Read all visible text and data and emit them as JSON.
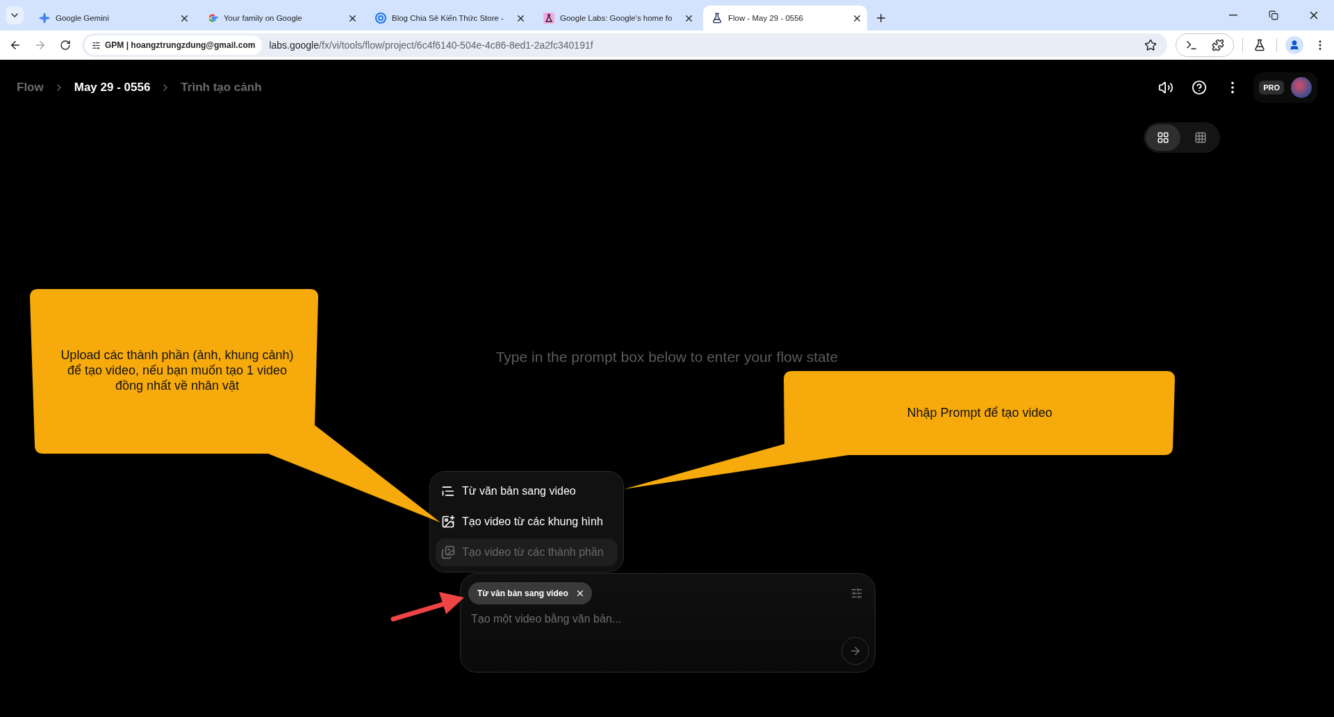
{
  "browser": {
    "tabs": [
      {
        "title": "Google Gemini",
        "kind": "sparkle",
        "selected": false
      },
      {
        "title": "Your family on Google",
        "kind": "google",
        "selected": false
      },
      {
        "title": "Blog Chia Sẻ Kiến Thức Store -",
        "kind": "blog",
        "selected": false
      },
      {
        "title": "Google Labs: Google's home fo",
        "kind": "labs",
        "selected": false
      },
      {
        "title": "Flow - May 29 - 0556",
        "kind": "flask",
        "selected": true
      }
    ],
    "address_bar": {
      "site_chip": "GPM | hoangztrungzdung@gmail.com",
      "url_host": "labs.google",
      "url_path": "/fx/vi/tools/flow/project/6c4f6140-504e-4c86-8ed1-2a2fc340191f"
    }
  },
  "breadcrumb": [
    {
      "label": "Flow",
      "selected": false
    },
    {
      "label": "May 29 - 0556",
      "selected": true
    },
    {
      "label": "Trình tạo cảnh",
      "selected": false
    }
  ],
  "plan_badge": "PRO",
  "view_toggle": [
    {
      "kind": "grid",
      "selected": true
    },
    {
      "kind": "table",
      "selected": false
    }
  ],
  "empty_state": "Type in the prompt box below to enter your flow state",
  "mode_menu": [
    {
      "label": "Từ văn bản sang video",
      "kind": "text",
      "disabled": false,
      "highlighted": false
    },
    {
      "label": "Tạo video từ các khung hình",
      "kind": "frames",
      "disabled": false,
      "highlighted": false
    },
    {
      "label": "Tạo video từ các thành phần",
      "kind": "ingredients",
      "disabled": true,
      "highlighted": true
    }
  ],
  "prompt": {
    "mode_chip": "Từ văn bản sang video",
    "placeholder": "Tạo một video bằng văn bản..."
  },
  "callouts": [
    {
      "text": "Upload các thành phần (ảnh, khung cảnh) để tạo video, nếu bạn muốn tạo 1 video đồng nhất về nhân vật"
    },
    {
      "text": "Nhập Prompt để tạo video"
    }
  ]
}
